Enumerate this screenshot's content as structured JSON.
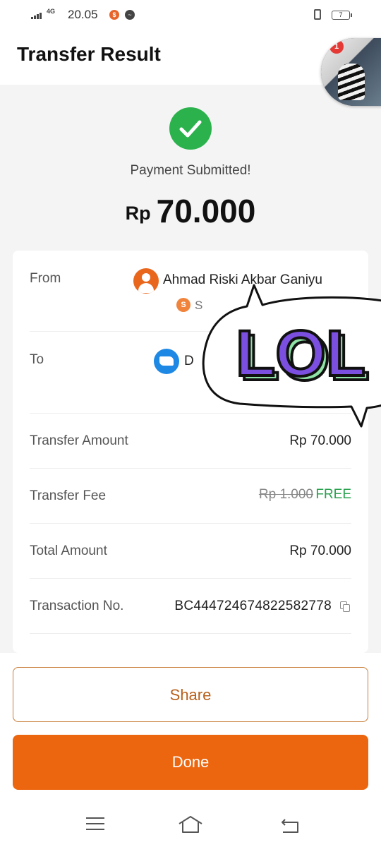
{
  "status_bar": {
    "network": "4G",
    "time": "20.05",
    "battery": "7"
  },
  "header": {
    "title": "Transfer Result"
  },
  "chat_head": {
    "badge": "1"
  },
  "result": {
    "status": "Payment Submitted!",
    "currency": "Rp",
    "amount": "70.000"
  },
  "details": {
    "from": {
      "label": "From",
      "name": "Ahmad Riski Akbar Ganiyu",
      "sub_icon_text": "S",
      "sub_text": "S"
    },
    "to": {
      "label": "To",
      "name": "D"
    },
    "transfer_amount": {
      "label": "Transfer Amount",
      "value": "Rp 70.000"
    },
    "transfer_fee": {
      "label": "Transfer Fee",
      "original": "Rp 1.000",
      "value": "FREE"
    },
    "total_amount": {
      "label": "Total Amount",
      "value": "Rp 70.000"
    },
    "transaction_no": {
      "label": "Transaction No.",
      "value": "BC444724674822582778"
    }
  },
  "sticker": {
    "text": "LOL"
  },
  "actions": {
    "share_label": "Share",
    "done_label": "Done"
  },
  "colors": {
    "accent": "#ec6610",
    "success": "#2bb24c",
    "free": "#2aa14f",
    "sticker_fill": "#7b4fe0",
    "sticker_shadow": "#8fe3a6"
  }
}
